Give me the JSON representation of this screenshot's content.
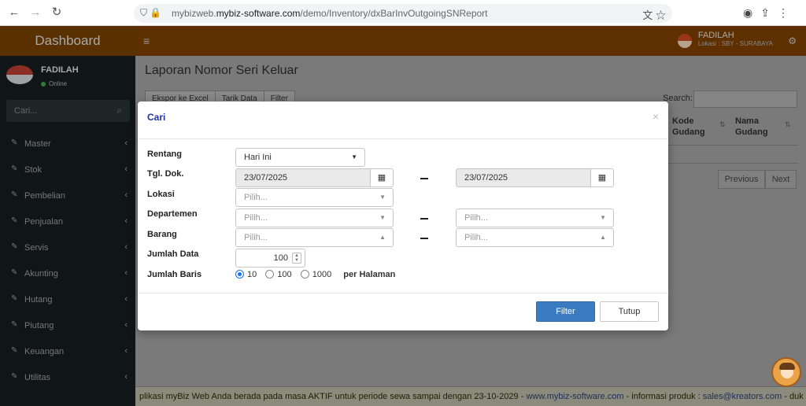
{
  "browser": {
    "url_prefix": "mybizweb.",
    "url_domain": "mybiz-software.com",
    "url_path": "/demo/Inventory/dxBarInvOutgoingSNReport"
  },
  "topbar": {
    "brand": "Dashboard",
    "user_name": "FADILAH",
    "location": "Lokasi : SBY - SURABAYA"
  },
  "sidebar": {
    "user_name": "FADILAH",
    "status": "Online",
    "search_placeholder": "Cari...",
    "items": [
      {
        "label": "Master"
      },
      {
        "label": "Stok"
      },
      {
        "label": "Pembelian"
      },
      {
        "label": "Penjualan"
      },
      {
        "label": "Servis"
      },
      {
        "label": "Akunting"
      },
      {
        "label": "Hutang"
      },
      {
        "label": "Piutang"
      },
      {
        "label": "Keuangan"
      },
      {
        "label": "Utilitas"
      }
    ]
  },
  "page": {
    "title": "Laporan Nomor Seri Keluar",
    "buttons": [
      "Ekspor ke Excel",
      "Tarik Data",
      "Filter"
    ],
    "search_label": "Search:",
    "columns": [
      "Kode Gudang",
      "Nama Gudang"
    ],
    "pager_prev": "Previous",
    "pager_next": "Next"
  },
  "footer": {
    "text1": "plikasi myBiz Web Anda berada pada masa AKTIF untuk periode sewa sampai dengan 23-10-2029",
    "sep1": " - ",
    "site": "www.mybiz-software.com",
    "text2": " - informasi produk : ",
    "email": "sales@kreators.com",
    "text3": " - duk"
  },
  "modal": {
    "title": "Cari",
    "labels": {
      "rentang": "Rentang",
      "tgl": "Tgl. Dok.",
      "lokasi": "Lokasi",
      "departemen": "Departemen",
      "barang": "Barang",
      "jumlah_data": "Jumlah Data",
      "jumlah_baris": "Jumlah Baris"
    },
    "rentang_value": "Hari Ini",
    "date_from": "23/07/2025",
    "date_to": "23/07/2025",
    "placeholder": "Pilih...",
    "jumlah_data_value": "100",
    "rows_options": [
      "10",
      "100",
      "1000"
    ],
    "rows_selected": "10",
    "per_page": "per Halaman",
    "filter_label": "Filter",
    "close_label": "Tutup"
  }
}
